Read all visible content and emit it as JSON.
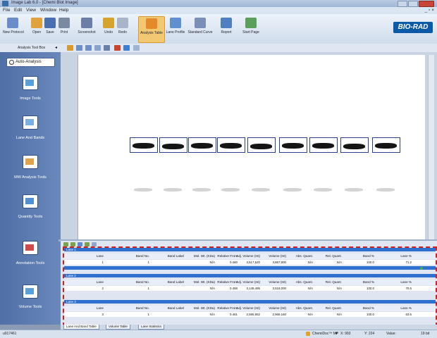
{
  "window": {
    "title": "Image Lab 6.0 - [Chemi Blot Image]"
  },
  "menu": [
    "File",
    "Edit",
    "View",
    "Window",
    "Help"
  ],
  "toolbar": {
    "buttons": [
      {
        "label": "New Protocol",
        "color": "#6a8cc8"
      },
      {
        "label": "Open",
        "color": "#e2a23b"
      },
      {
        "label": "Save",
        "color": "#4a6fb0"
      },
      {
        "label": "Print",
        "color": "#7a8aa0"
      },
      {
        "label": "Screenshot",
        "color": "#6b7fa6"
      },
      {
        "label": "Undo",
        "color": "#d6a42c"
      },
      {
        "label": "Redo",
        "color": "#a8b4c8"
      },
      {
        "label": "Analysis Table",
        "color": "#e58a2b",
        "active": true
      },
      {
        "label": "Lane Profile",
        "color": "#5e8fd0"
      },
      {
        "label": "Standard Curve",
        "color": "#7a8fb5"
      },
      {
        "label": "Report",
        "color": "#4f7fc0"
      },
      {
        "label": "Start Page",
        "color": "#5aa05a"
      }
    ],
    "brand": "BIO-RAD"
  },
  "analysis_toolbox": {
    "label": "Analysis Tool Box"
  },
  "sidebar": {
    "auto_analysis": "Auto-Analysis",
    "tools": [
      "Image Tools",
      "Lane And Bands",
      "MW Analysis Tools",
      "Quantity Tools",
      "Annotation Tools",
      "Volume Tools"
    ]
  },
  "table": {
    "headers": [
      "Lane",
      "Band No.",
      "Band Label",
      "Mol. Wt. (KDa)",
      "Relative Front",
      "Adj. Volume (Int)",
      "Volume (Int)",
      "Abs. Quant.",
      "Rel. Quant.",
      "Band %",
      "Lane %"
    ],
    "lanes": [
      {
        "title": "Lane 1",
        "row": [
          "1",
          "1",
          "",
          "N/A",
          "0.460",
          "3,517,520",
          "3,887,800",
          "N/A",
          "N/A",
          "100.0",
          "71.2"
        ]
      },
      {
        "title": "Lane 2",
        "row": [
          "2",
          "1",
          "",
          "N/A",
          "0.458",
          "3,149,495",
          "3,518,000",
          "N/A",
          "N/A",
          "100.0",
          "70.6"
        ]
      },
      {
        "title": "Lane 3",
        "row": [
          "3",
          "1",
          "",
          "N/A",
          "0.461",
          "2,595,952",
          "2,968,160",
          "N/A",
          "N/A",
          "100.0",
          "63.6"
        ]
      }
    ]
  },
  "bottom_tabs": [
    "Lane And Band Table",
    "Volume Table",
    "Lane Statistics"
  ],
  "status": {
    "left": "u017461",
    "device": "ChemiDoc™ MP",
    "x": "X: 993",
    "y": "Y: 224",
    "value": "Value:",
    "bits": "19 bit"
  }
}
